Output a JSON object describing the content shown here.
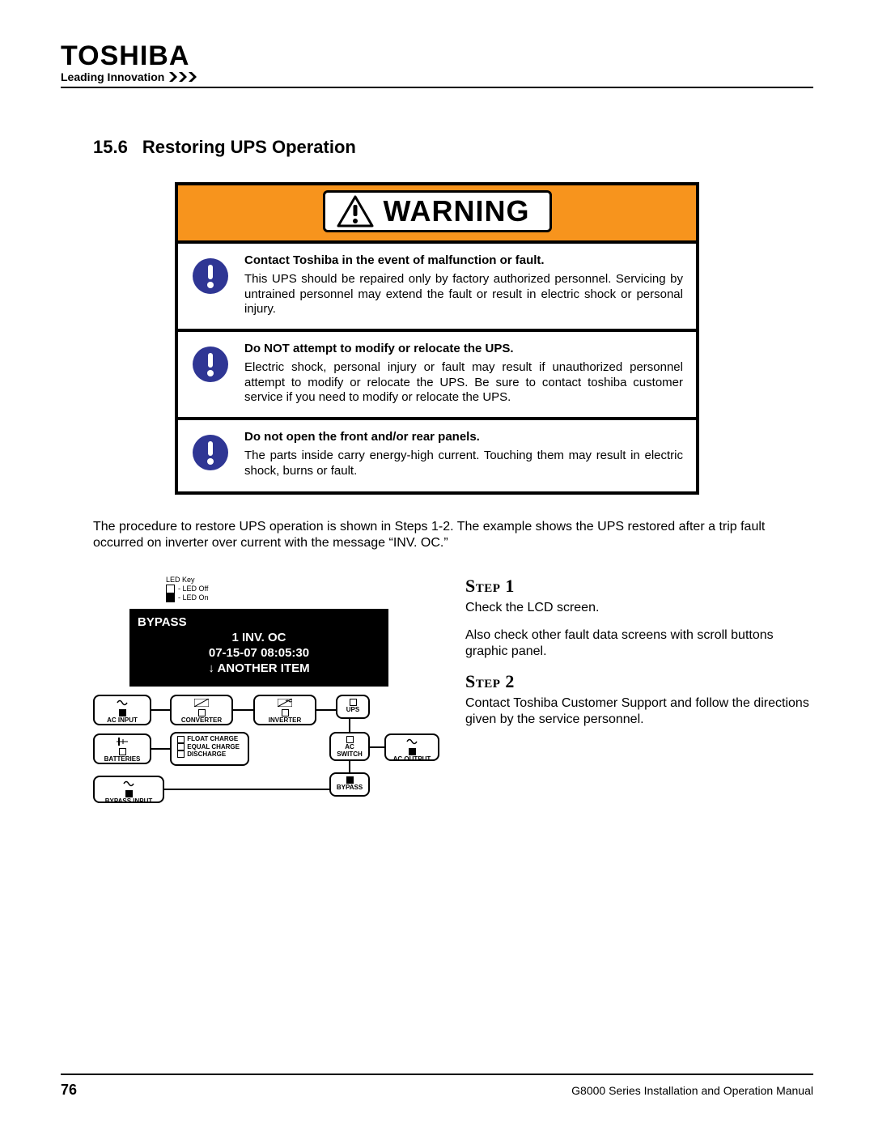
{
  "brand": "TOSHIBA",
  "tagline": "Leading Innovation",
  "section": {
    "number": "15.6",
    "title": "Restoring UPS Operation"
  },
  "warning": {
    "header": "WARNING",
    "items": [
      {
        "head": "Contact Toshiba in the event of malfunction or fault.",
        "body": "This UPS should be repaired only by factory authorized personnel. Servicing by untrained personnel may extend the fault or result in electric shock or personal injury."
      },
      {
        "head": "Do NOT attempt to modify or relocate the UPS.",
        "body": "Electric shock, personal injury or fault may result if unauthorized personnel attempt to modify or relocate the UPS. Be sure to contact toshiba customer service if you need to modify or relocate the UPS."
      },
      {
        "head": "Do not open the front and/or rear panels.",
        "body": "The parts inside carry energy-high current. Touching them may result in electric shock, burns or fault."
      }
    ]
  },
  "intro": "The procedure to restore UPS operation is shown in Steps 1-2. The example shows the UPS restored after a trip fault occurred on inverter over current with the message “INV. OC.”",
  "led_key": {
    "title": "LED Key",
    "off": "- LED Off",
    "on": "- LED On"
  },
  "lcd": {
    "mode": "BYPASS",
    "line1": "1 INV. OC",
    "line2": "07-15-07 08:05:30",
    "line3": "↓ ANOTHER ITEM"
  },
  "flow": {
    "ac_input": "AC INPUT",
    "converter": "CONVERTER",
    "inverter": "INVERTER",
    "ups": "UPS",
    "batteries": "BATTERIES",
    "float": "FLOAT CHARGE",
    "equal": "EQUAL CHARGE",
    "discharge": "DISCHARGE",
    "ac_switch": "AC\nSWITCH",
    "ac_output": "AC OUTPUT",
    "bypass_input": "BYPASS INPUT",
    "bypass": "BYPASS"
  },
  "steps": [
    {
      "title": "Step 1",
      "paras": [
        "Check the LCD screen.",
        "Also check other fault data screens with scroll buttons graphic panel."
      ]
    },
    {
      "title": "Step 2",
      "paras": [
        "Contact Toshiba Customer Support and follow the directions given by the service personnel."
      ]
    }
  ],
  "footer": {
    "page": "76",
    "doc": "G8000 Series Installation and Operation Manual"
  }
}
